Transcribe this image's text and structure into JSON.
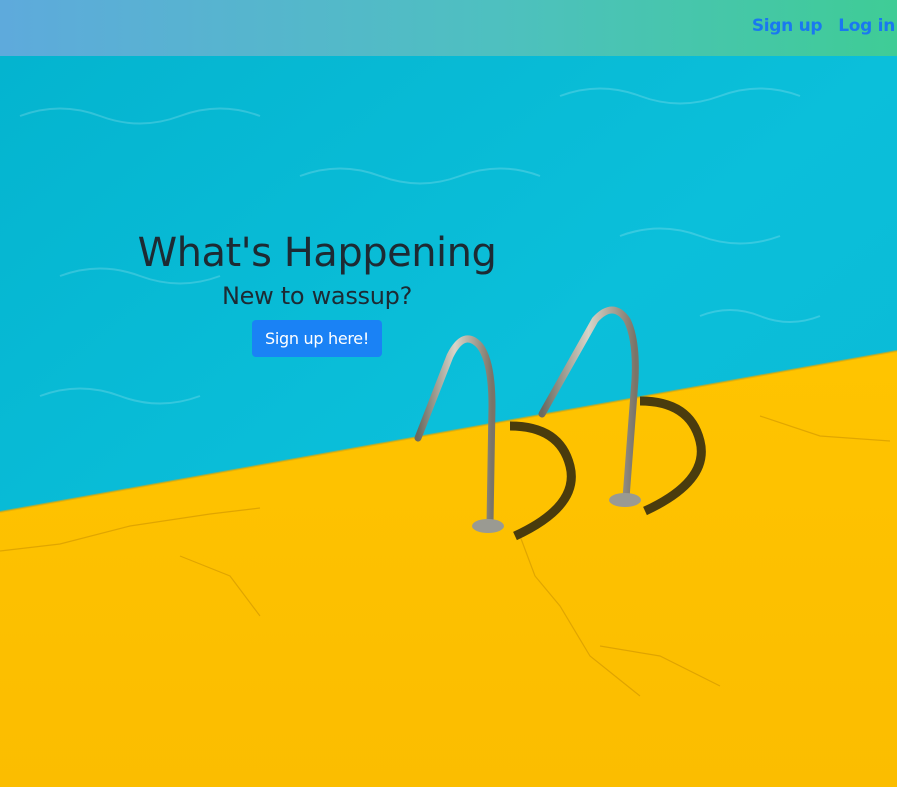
{
  "nav": {
    "signup_label": "Sign up",
    "login_label": "Log in"
  },
  "hero": {
    "title": "What's Happening",
    "subtitle": "New to wassup?",
    "button_label": "Sign up here!"
  },
  "colors": {
    "pool_water": "#05b8d6",
    "pool_deck": "#ffc000",
    "link": "#1a78f0",
    "button": "#1a82f5"
  }
}
